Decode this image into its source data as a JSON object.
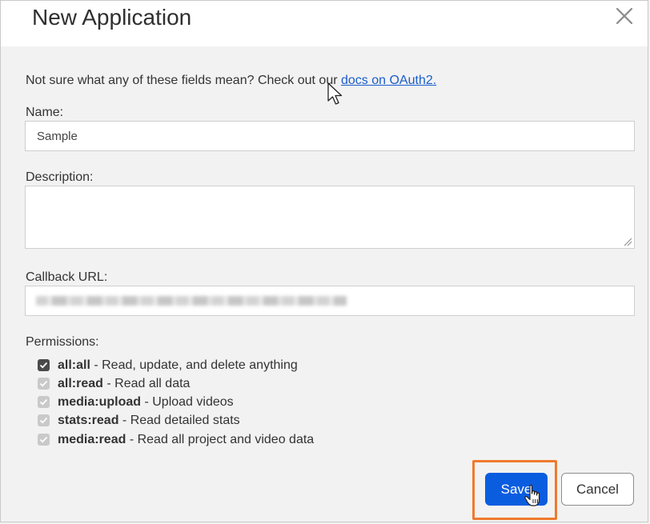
{
  "dialog": {
    "title": "New Application",
    "close_icon": "close-icon"
  },
  "intro": {
    "text": "Not sure what any of these fields mean? Check out our ",
    "link": "docs on OAuth2."
  },
  "fields": {
    "name_label": "Name:",
    "name_value": "Sample",
    "description_label": "Description:",
    "description_value": "",
    "callback_label": "Callback URL:"
  },
  "permissions": {
    "label": "Permissions:",
    "items": [
      {
        "scope": "all:all",
        "desc": " - Read, update, and delete anything",
        "checked": true,
        "disabled": false
      },
      {
        "scope": "all:read",
        "desc": " - Read all data",
        "checked": true,
        "disabled": true
      },
      {
        "scope": "media:upload",
        "desc": " - Upload videos",
        "checked": true,
        "disabled": true
      },
      {
        "scope": "stats:read",
        "desc": " - Read detailed stats",
        "checked": true,
        "disabled": true
      },
      {
        "scope": "media:read",
        "desc": " - Read all project and video data",
        "checked": true,
        "disabled": true
      }
    ]
  },
  "actions": {
    "save_label": "Save",
    "cancel_label": "Cancel",
    "highlight_color": "#ef7a2e",
    "primary_color": "#0b5de0"
  }
}
